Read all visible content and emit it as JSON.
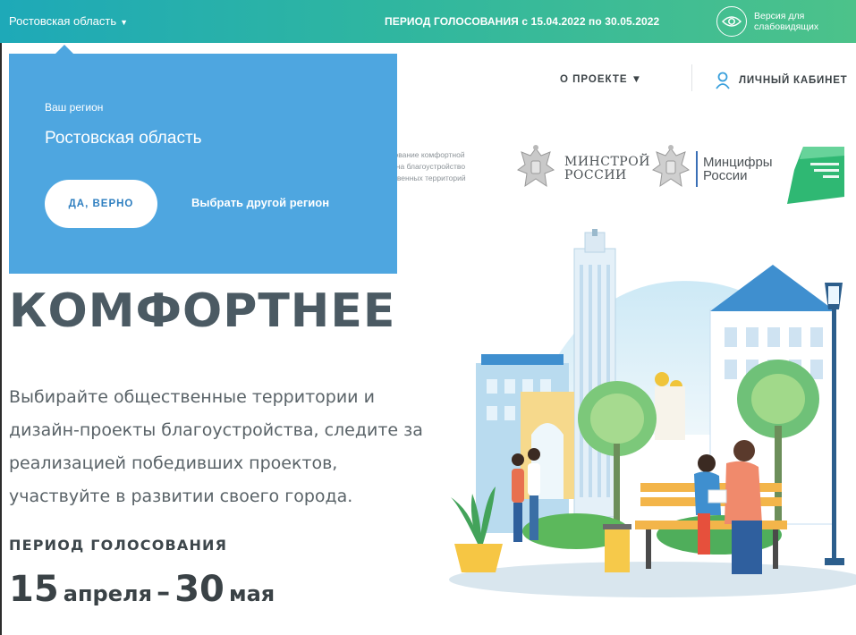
{
  "topbar": {
    "region": "Ростовская область",
    "period": "ПЕРИОД ГОЛОСОВАНИЯ  с 15.04.2022 по 30.05.2022",
    "accessibility_line1": "Версия для",
    "accessibility_line2": "слабовидящих",
    "colors": {
      "gradient_start": "#1ea9b8",
      "gradient_end": "#4cc28a"
    }
  },
  "nav": {
    "about": "О ПРОЕКТЕ ▼",
    "cabinet": "ЛИЧНЫЙ КАБИНЕТ"
  },
  "partners": {
    "text_line1": "ирование комфортной",
    "text_line2": "ен на благоустройство",
    "text_line3": "ественных территорий",
    "minstroy_line1": "МИНСТРОЙ",
    "minstroy_line2": "РОССИИ",
    "mincifry_line1": "Минцифры",
    "mincifry_line2": "России"
  },
  "popup": {
    "label": "Ваш регион",
    "region": "Ростовская область",
    "confirm": "ДА, ВЕРНО",
    "other": "Выбрать другой регион",
    "color": "#4ea6e0"
  },
  "hero": {
    "title": "КОМФОРТНЕЕ",
    "desc": [
      "Выбирайте общественные территории и",
      "дизайн-проекты благоустройства, следите за",
      "реализацией победивших проектов,",
      "участвуйте в развитии своего города."
    ],
    "period_label": "ПЕРИОД ГОЛОСОВАНИЯ",
    "date_start_num": "15",
    "date_start_month": "апреля",
    "dash": "–",
    "date_end_num": "30",
    "date_end_month": "мая"
  }
}
